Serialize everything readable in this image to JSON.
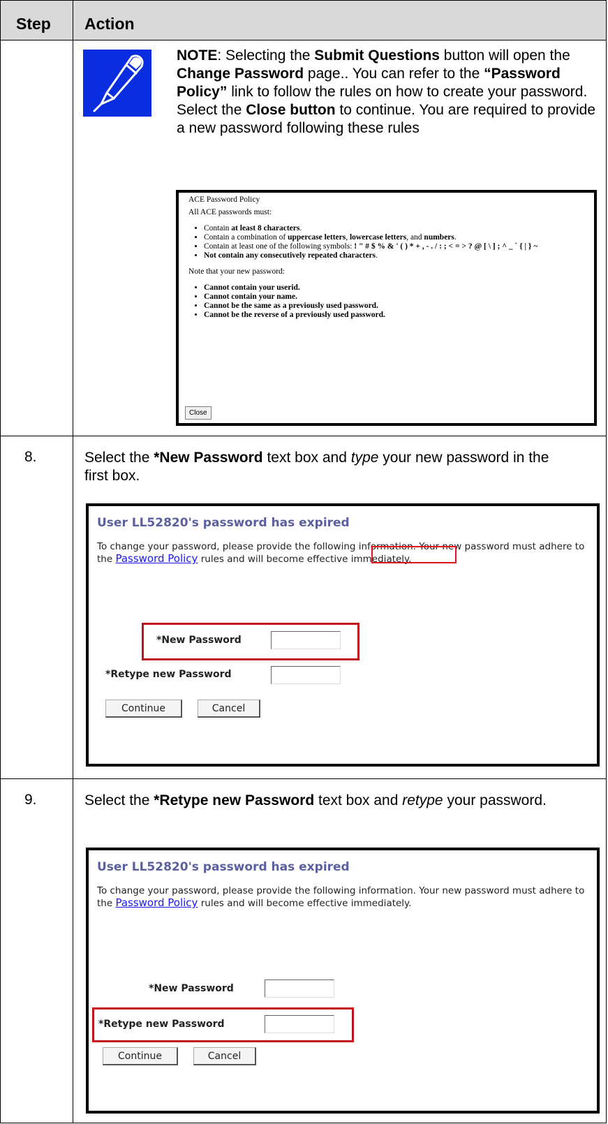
{
  "table": {
    "header": {
      "step": "Step",
      "action": "Action"
    }
  },
  "note": {
    "prefix": "NOTE",
    "sentence1_a": ": Selecting the ",
    "submit_btn": "Submit Questions",
    "sentence1_b": " button will open the ",
    "change_pw": "Change Password",
    "sentence1_c": " page.. You can refer to the ",
    "policy_link": "“Password Policy”",
    "sentence2": " link to follow the rules on how to create your password. Select the ",
    "close_btn": "Close button",
    "sentence3": " to continue. You are required to provide a new password following these rules",
    "icon": "pen-icon"
  },
  "policy": {
    "title": "ACE Password Policy",
    "intro": "All ACE passwords must:",
    "rules": [
      {
        "pre": "Contain ",
        "bold": "at least 8 characters",
        "post": "."
      },
      {
        "pre": "Contain a combination of ",
        "bold": "uppercase letters",
        "mid": ", ",
        "bold2": "lowercase letters",
        "mid2": ", and ",
        "bold3": "numbers",
        "post": "."
      },
      {
        "pre": "Contain at least one of the following symbols: ",
        "bold": "! \" # $ % & ' ( ) * + , - . / : ; < = > ? @ [ \\ ] ; ^ _ ` { | } ~",
        "post": ""
      },
      {
        "pre": "",
        "bold": "Not contain any consecutively repeated characters",
        "post": "."
      }
    ],
    "note_intro": "Note that your new password:",
    "restrictions": [
      "Cannot contain your userid.",
      "Cannot contain your name.",
      "Cannot be the same as a previously used password.",
      "Cannot be the reverse of a previously used password."
    ],
    "close_label": "Close"
  },
  "steps": [
    {
      "number": "8.",
      "pre": "Select the ",
      "target": "*New Password",
      "mid": " text box and ",
      "verb": "type",
      "post": " your new password in the first box."
    },
    {
      "number": "9.",
      "pre": "Select the ",
      "target": "*Retype new Password",
      "mid": " text box and ",
      "verb": "retype",
      "post": " your password."
    }
  ],
  "form": {
    "title": "User LL52820's password has expired",
    "desc_a": "To change your password, please provide the following information. Your new password must adhere to the ",
    "link": "Password Policy",
    "desc_b": " rules and will become effective immediately.",
    "new_pw_label": "*New Password",
    "retype_label": "*Retype new Password",
    "continue_label": "Continue",
    "cancel_label": "Cancel",
    "highlight_color": "#c0141c"
  }
}
